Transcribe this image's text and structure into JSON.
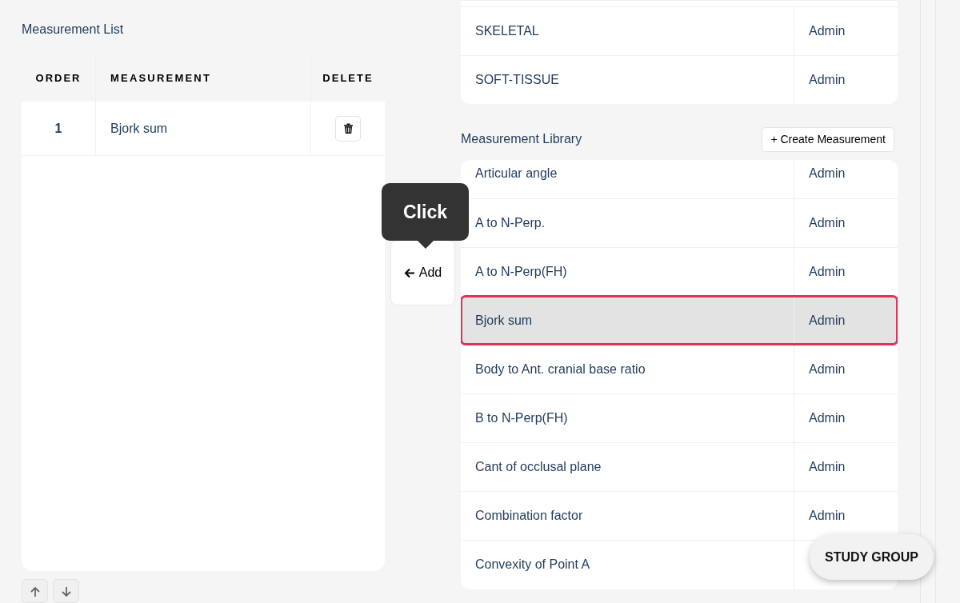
{
  "measurement_list": {
    "title": "Measurement List",
    "columns": [
      "ORDER",
      "MEASUREMENT",
      "DELETE"
    ],
    "rows": [
      {
        "order": "1",
        "measurement": "Bjork sum"
      }
    ]
  },
  "add_button": {
    "label": "Add"
  },
  "tooltip": {
    "text": "Click"
  },
  "groups": [
    {
      "name": "SKELETAL",
      "owner": "Admin"
    },
    {
      "name": "SOFT-TISSUE",
      "owner": "Admin"
    }
  ],
  "measurement_library": {
    "title": "Measurement Library",
    "create_button": "+ Create Measurement",
    "rows": [
      {
        "name": "Articular angle",
        "owner": "Admin",
        "selected": false
      },
      {
        "name": "A to N-Perp.",
        "owner": "Admin",
        "selected": false
      },
      {
        "name": "A to N-Perp(FH)",
        "owner": "Admin",
        "selected": false
      },
      {
        "name": "Bjork sum",
        "owner": "Admin",
        "selected": true
      },
      {
        "name": "Body to Ant. cranial base ratio",
        "owner": "Admin",
        "selected": false
      },
      {
        "name": "B to N-Perp(FH)",
        "owner": "Admin",
        "selected": false
      },
      {
        "name": "Cant of occlusal plane",
        "owner": "Admin",
        "selected": false
      },
      {
        "name": "Combination factor",
        "owner": "Admin",
        "selected": false
      },
      {
        "name": "Convexity of Point A",
        "selected": false
      }
    ]
  },
  "study_group_button": {
    "label": "STUDY GROUP"
  }
}
